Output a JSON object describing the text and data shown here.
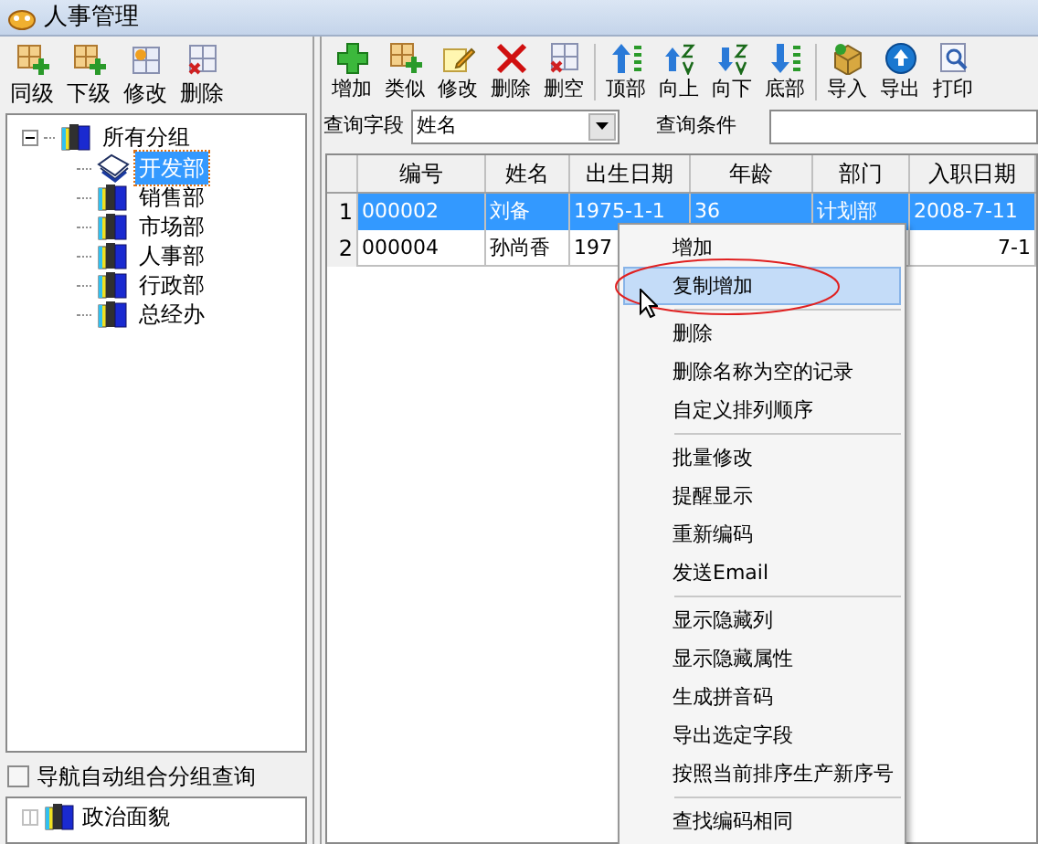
{
  "window": {
    "title": "人事管理"
  },
  "left_toolbar": [
    {
      "label": "同级",
      "kind": "add"
    },
    {
      "label": "下级",
      "kind": "add"
    },
    {
      "label": "修改",
      "kind": "grid"
    },
    {
      "label": "删除",
      "kind": "gridx"
    }
  ],
  "tree": {
    "label": "所有分组",
    "expanded": true,
    "children": [
      {
        "label": "开发部",
        "selected": true
      },
      {
        "label": "销售部",
        "selected": false
      },
      {
        "label": "市场部",
        "selected": false
      },
      {
        "label": "人事部",
        "selected": false
      },
      {
        "label": "行政部",
        "selected": false
      },
      {
        "label": "总经办",
        "selected": false
      }
    ]
  },
  "group_query": {
    "label": "导航自动组合分组查询",
    "checked": false
  },
  "second_tree": [
    {
      "label": "政治面貌",
      "expanded": false
    }
  ],
  "toolbar": [
    {
      "label": "增加",
      "kind": "plus"
    },
    {
      "label": "类似",
      "kind": "add"
    },
    {
      "label": "修改",
      "kind": "edit"
    },
    {
      "label": "删除",
      "kind": "x"
    },
    {
      "label": "删空",
      "kind": "gridx"
    },
    {
      "kind": "separator"
    },
    {
      "label": "顶部",
      "kind": "top"
    },
    {
      "label": "向上",
      "kind": "up"
    },
    {
      "label": "向下",
      "kind": "down"
    },
    {
      "label": "底部",
      "kind": "bottom"
    },
    {
      "kind": "separator"
    },
    {
      "label": "导入",
      "kind": "import"
    },
    {
      "label": "导出",
      "kind": "export"
    },
    {
      "label": "打印",
      "kind": "print"
    }
  ],
  "query": {
    "field_label": "查询字段",
    "field_value": "姓名",
    "condition_label": "查询条件"
  },
  "table": {
    "columns": [
      "编号",
      "姓名",
      "出生日期",
      "年龄",
      "部门",
      "入职日期"
    ],
    "rows": [
      {
        "number": "1",
        "selected": true,
        "cells": [
          "000002",
          "刘备",
          "1975-1-1",
          "36",
          "计划部",
          "2008-7-11"
        ]
      },
      {
        "number": "2",
        "selected": false,
        "cells": [
          "000004",
          "孙尚香",
          "197",
          "",
          "",
          "7-1"
        ]
      }
    ]
  },
  "context_menu": [
    {
      "kind": "item",
      "label": "增加",
      "selected": false
    },
    {
      "kind": "item",
      "label": "复制增加",
      "selected": true
    },
    {
      "kind": "separator"
    },
    {
      "kind": "item",
      "label": "删除",
      "selected": false
    },
    {
      "kind": "item",
      "label": "删除名称为空的记录",
      "selected": false
    },
    {
      "kind": "item",
      "label": "自定义排列顺序",
      "selected": false
    },
    {
      "kind": "separator"
    },
    {
      "kind": "item",
      "label": "批量修改",
      "selected": false
    },
    {
      "kind": "item",
      "label": "提醒显示",
      "selected": false
    },
    {
      "kind": "item",
      "label": "重新编码",
      "selected": false
    },
    {
      "kind": "item",
      "label": "发送Email",
      "selected": false
    },
    {
      "kind": "separator"
    },
    {
      "kind": "item",
      "label": "显示隐藏列",
      "selected": false
    },
    {
      "kind": "item",
      "label": "显示隐藏属性",
      "selected": false
    },
    {
      "kind": "item",
      "label": "生成拼音码",
      "selected": false
    },
    {
      "kind": "item",
      "label": "导出选定字段",
      "selected": false
    },
    {
      "kind": "item",
      "label": "按照当前排序生产新序号",
      "selected": false
    },
    {
      "kind": "separator"
    },
    {
      "kind": "item",
      "label": "查找编码相同",
      "selected": false
    }
  ]
}
